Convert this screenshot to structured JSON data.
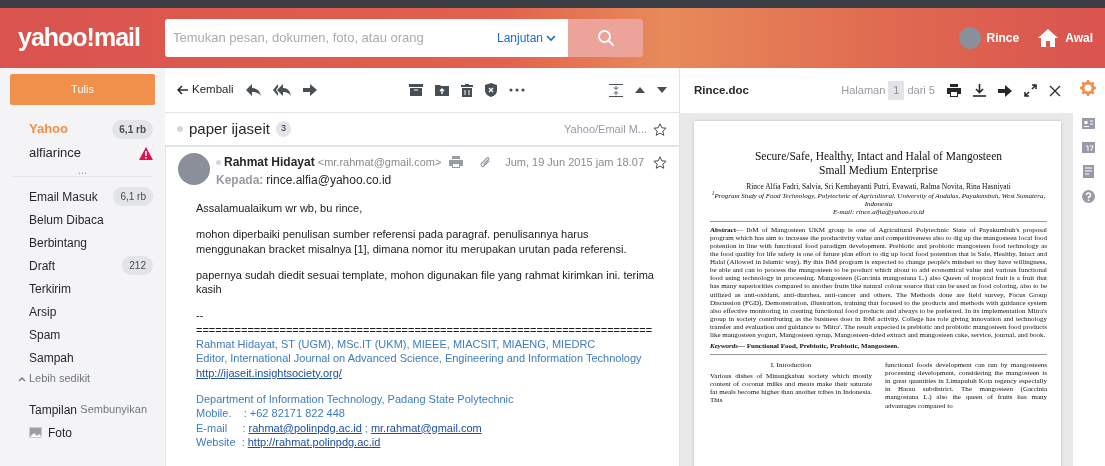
{
  "header": {
    "logo": "yahoo!mail",
    "search_placeholder": "Temukan pesan, dokumen, foto, atau orang",
    "advanced": "Lanjutan",
    "user": "Rince",
    "home": "Awal"
  },
  "sidebar": {
    "compose": "Tulis",
    "accounts": [
      {
        "name": "Yahoo",
        "count": "6,1 rb",
        "warning": false,
        "selected": true
      },
      {
        "name": "alfiarince",
        "warning": true,
        "selected": false
      }
    ],
    "more": "...",
    "folders": [
      {
        "label": "Email Masuk",
        "count": "6,1 rb"
      },
      {
        "label": "Belum Dibaca"
      },
      {
        "label": "Berbintang"
      },
      {
        "label": "Draft",
        "count": "212"
      },
      {
        "label": "Terkirim"
      },
      {
        "label": "Arsip"
      },
      {
        "label": "Spam"
      },
      {
        "label": "Sampah"
      }
    ],
    "less_toggle": "Lebih sedikit",
    "views": {
      "label": "Tampilan",
      "action": "Sembunyikan",
      "items": [
        {
          "label": "Foto"
        }
      ]
    }
  },
  "toolbar": {
    "back": "Kembali"
  },
  "thread": {
    "subject": "paper ijaseit",
    "count": "3",
    "folder": "Yahoo/Email M...",
    "starred": false
  },
  "message": {
    "sender_name": "Rahmat Hidayat",
    "sender_email": "<mr.rahmat@gmail.com>",
    "to_label": "Kepada:",
    "to": "rince.alfia@yahoo.co.id",
    "date": "Jum, 19 Jun 2015 jam 18.07",
    "starred": false,
    "body": [
      "Assalamualaikum wr wb, bu rince,",
      "mohon diperbaiki penulisan sumber referensi pada paragraf. penulisannya harus menggunakan bracket misalnya [1], dimana nomor itu merupakan urutan pada referensi.",
      "papernya sudah diedit sesuai template, mohon digunakan file yang rahmat kirimkan ini. terima kasih"
    ],
    "signature_blocks": [
      [
        [
          {
            "text": "--",
            "kind": "plain"
          }
        ],
        [
          {
            "text": "=======================================================================",
            "kind": "plain"
          }
        ],
        [
          {
            "text": "Rahmat Hidayat, ST (UGM), MSc.IT (UKM), MIEEE, MIACSIT, MIAENG, MIEDRC",
            "kind": "info"
          }
        ],
        [
          {
            "text": "Editor, International Journal on Advanced Science, Engineering and Information Technology",
            "kind": "info"
          }
        ],
        [
          {
            "text": "http://ijaseit.insightsociety.org/",
            "kind": "link"
          }
        ]
      ],
      [
        [
          {
            "text": "Department of Information Technology, Padang State Polytechnic",
            "kind": "info"
          }
        ],
        [
          {
            "text": "Mobile.    : +62 82171 822 448",
            "kind": "info"
          }
        ],
        [
          {
            "text": "E-mail     :",
            "kind": "info"
          },
          {
            "text": "rahmat@polinpdg.ac.id",
            "kind": "link"
          },
          {
            "text": ";",
            "kind": "info"
          },
          {
            "text": "mr.rahmat@gmail.com",
            "kind": "link"
          }
        ],
        [
          {
            "text": "Website  :",
            "kind": "info"
          },
          {
            "text": "http://rahmat.polinpdg.ac.id",
            "kind": "link"
          }
        ]
      ]
    ]
  },
  "viewer": {
    "filename": "Rince.doc",
    "page_label": "Halaman",
    "page": "1",
    "page_of": "dari 5",
    "document": {
      "title": [
        "Secure/Safe, Healthy, Intact and Halal of Mangosteen",
        "Small Medium Enterprise"
      ],
      "authors": "Rince Alfia Fadri, Salvia, Sri Kembayanti Putri, Evawati, Ralma Novita, Rina Hasniyati",
      "affiliation": "$^{1}$Program Study of Food Technology, Polytechnic of Agricultural, University of Andalas, Payakumbuh, West Sumatera, Indonesia",
      "email": "E-mail: rince.alfia@yahoo.co.id",
      "abstract": "**Abstract**— IbM of Mangosteen UKM group is one of Agricultural Polytechnic State of Payakumbuh's proposal program which has aim to increase the productivity value and competitiveness also to dig up the mangosteen local food potention in line with functional food paradigm development. Prebiotic and probiotic mangosteen food technology as the food quality for life safety is one of future plan effort to dig up local food potention that is Safe, Healthy, Intact and Halal (Allowed in Islamic way). By this IbM program is expected to change people's mindset so they have willingness, be able and can to process the mangosteen to be product which about to add economical value and various functional food using technology in processing. Mangosteen (Garcinia mangostana L.) also Queen of tropical fruit is a fruit that has many superiorities compared to another fruits like natural colour source that can be used as food coloring, also to be utilized as anti-oxidant, anti-diarrhea, anti-cancer and others. The Methods done are field survey, Focus Group Discussion (FGD), Demonstration, illustration, training that focused to the products and methods with guidance system also effective monitoring in creating functional food products and always to be preferred. In its implementation Mitra's group in society contributing as the business doer in IbM activity. College has role giving innovation and technology transfer and evaluation and guidance to 'Mitra'. The result expected is prebiotic and probiotic mangosteen food products like mangosteen yogurt, Mangosteen syrup, Mangosteen-dried extract and mangosteen cake, service, journal, and book.",
      "keywords": "*Keywords*— Functional Food, Prebiotic, Probiotic, Mangosteen.",
      "section": "I.   Introduction",
      "column_1": "Various dishes of Minangkabau society which mostly content of coconut milks and meats make their saturate fat meals become higher than another tribes in Indonesia. This",
      "column_2": "functional foods development can run by mangosteens processing development, considering the mangosteen is in great quantities in Limapuluh Kota regency especially in Harau subdistrict. The mangosteen (Garcinia mangostana L.) also the queen of fruits has many advantages compared to"
    }
  }
}
